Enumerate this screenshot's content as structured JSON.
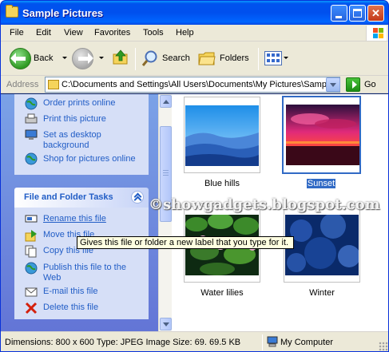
{
  "window": {
    "title": "Sample Pictures"
  },
  "menu": [
    "File",
    "Edit",
    "View",
    "Favorites",
    "Tools",
    "Help"
  ],
  "toolbar": {
    "back": "Back",
    "search": "Search",
    "folders": "Folders"
  },
  "address": {
    "label": "Address",
    "path": "C:\\Documents and Settings\\All Users\\Documents\\My Pictures\\Sample",
    "go": "Go"
  },
  "picture_tasks": [
    {
      "label": "Order prints online",
      "icon": "globe-icon"
    },
    {
      "label": "Print this picture",
      "icon": "printer-icon"
    },
    {
      "label": "Set as desktop background",
      "icon": "desktop-icon"
    },
    {
      "label": "Shop for pictures online",
      "icon": "globe-icon"
    }
  ],
  "file_tasks": {
    "title": "File and Folder Tasks",
    "items": [
      {
        "label": "Rename this file",
        "icon": "rename-icon"
      },
      {
        "label": "Move this file",
        "icon": "move-icon"
      },
      {
        "label": "Copy this file",
        "icon": "copy-icon"
      },
      {
        "label": "Publish this file to the Web",
        "icon": "globe-icon"
      },
      {
        "label": "E-mail this file",
        "icon": "email-icon"
      },
      {
        "label": "Delete this file",
        "icon": "delete-icon"
      }
    ]
  },
  "thumbnails": [
    {
      "name": "Blue hills",
      "selected": false
    },
    {
      "name": "Sunset",
      "selected": true
    },
    {
      "name": "Water lilies",
      "selected": false
    },
    {
      "name": "Winter",
      "selected": false
    }
  ],
  "tooltip": "Gives this file or folder a new label that you type for it.",
  "watermark": "©showgadgets.blogspot.com",
  "status": {
    "details": "Dimensions: 800 x 600 Type: JPEG Image Size: 69. 69.5 KB",
    "zone": "My Computer"
  },
  "colors": {
    "titlebar": "#0054e3",
    "task_link": "#215dc6",
    "selection": "#316ac5",
    "tooltip_bg": "#ffffe1"
  }
}
